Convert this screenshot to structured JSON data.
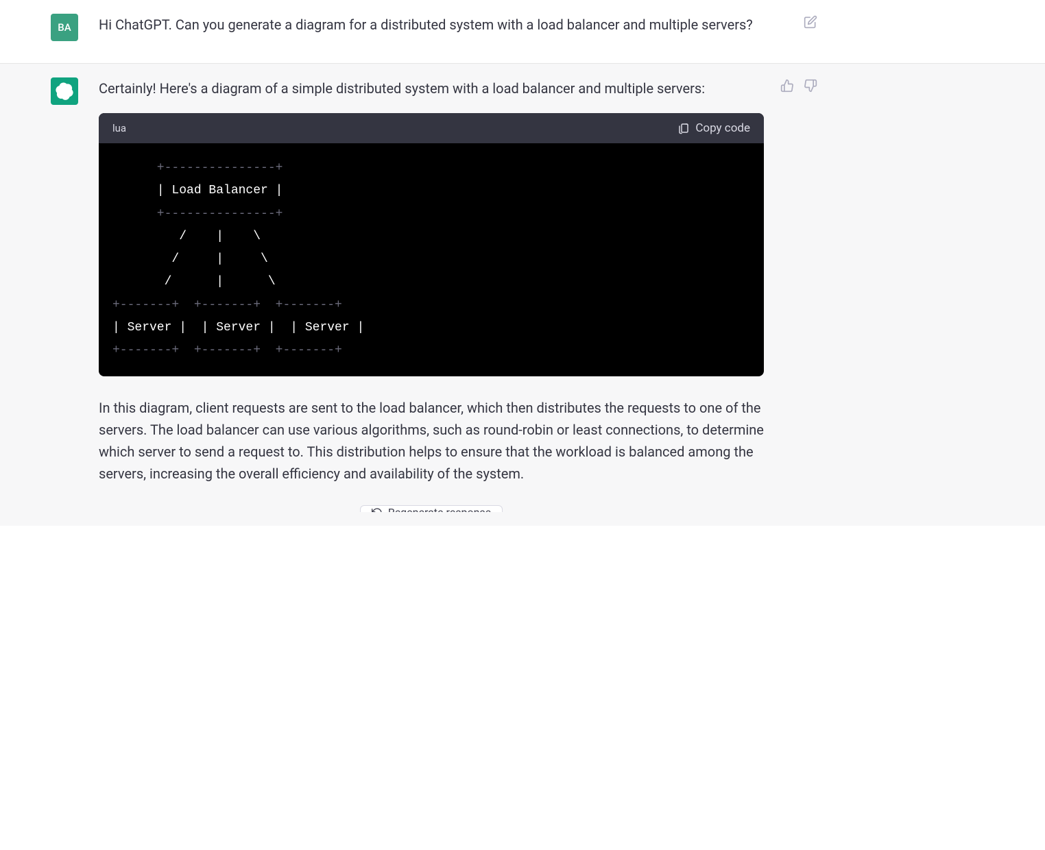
{
  "user": {
    "avatar_initials": "BA",
    "message": "Hi ChatGPT. Can you generate a diagram for a distributed system with a load balancer and multiple servers?"
  },
  "assistant": {
    "intro": "Certainly! Here's a diagram of a simple distributed system with a load balancer and multiple servers:",
    "code": {
      "language": "lua",
      "copy_label": "Copy code",
      "lines": [
        {
          "dim": "      +---------------+"
        },
        {
          "dim": "      ",
          "bright": "| Load Balancer |"
        },
        {
          "dim": "      +---------------+"
        },
        {
          "bright": "         /    |    \\"
        },
        {
          "bright": "        /     |     \\"
        },
        {
          "bright": "       /      |      \\"
        },
        {
          "dim": "+-------+  +-------+  +-------+"
        },
        {
          "dim": "",
          "bright": "| Server |  | Server |  | Server |"
        },
        {
          "dim": "+-------+  +-------+  +-------+"
        }
      ]
    },
    "explanation": "In this diagram, client requests are sent to the load balancer, which then distributes the requests to one of the servers. The load balancer can use various algorithms, such as round-robin or least connections, to determine which server to send a request to. This distribution helps to ensure that the workload is balanced among the servers, increasing the overall efficiency and availability of the system."
  },
  "regenerate_label": "Regenerate response"
}
